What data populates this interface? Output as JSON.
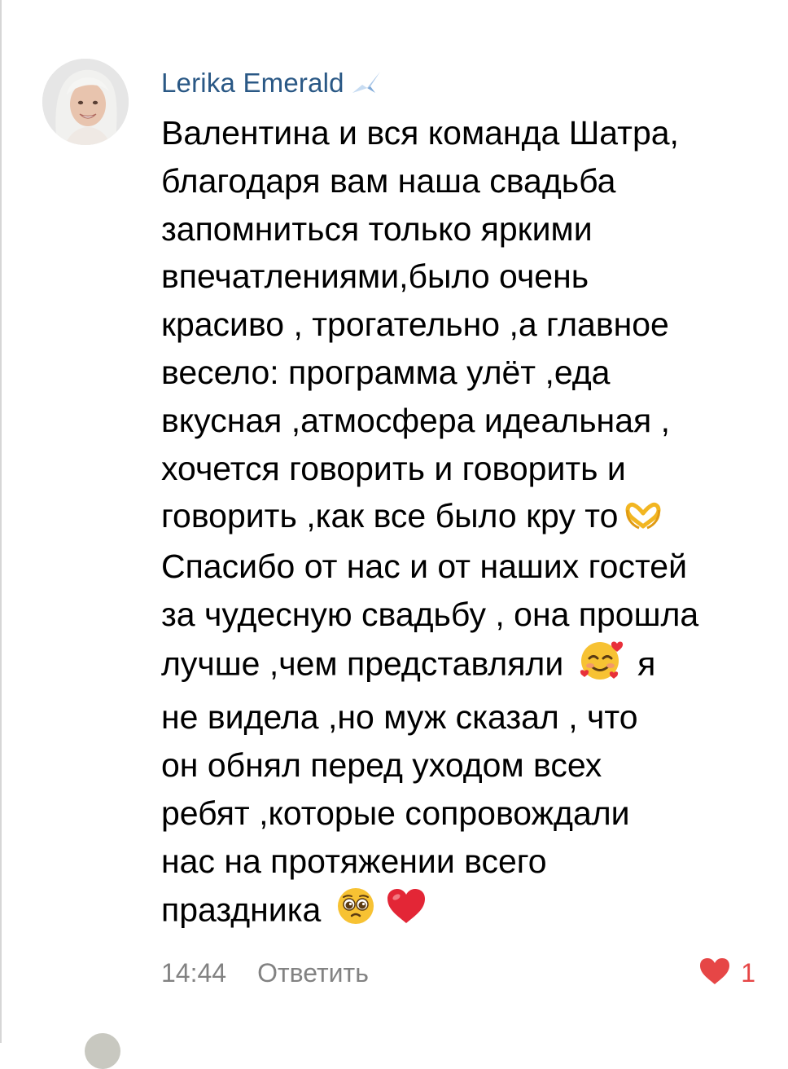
{
  "comment": {
    "author_name": "Lerika Emerald",
    "author_badge_icon": "origami-crane-icon",
    "body_lines": [
      "Валентина и вся команда Шатра,",
      "благодаря вам наша свадьба",
      "запомниться только яркими",
      "впечатлениями,было очень",
      "красиво , трогательно ,а главное",
      "весело: программа  улёт ,еда",
      "вкусная ,атмосфера идеальная ,",
      "хочется говорить и говорить и",
      "говорить ,как все было кру то",
      "Спасибо от нас и от наших гостей",
      "за чудесную свадьбу , она прошла",
      "лучше ,чем представляли",
      "я",
      "не видела ,но муж сказал , что",
      "он обнял перед уходом всех",
      "ребят ,которые сопровождали",
      "нас на протяжении всего",
      "праздника"
    ],
    "emojis": {
      "heart_hands": "heart-hands-emoji",
      "smiling_hearts": "smiling-face-with-hearts-emoji",
      "pleading": "pleading-face-emoji",
      "red_heart": "red-heart-emoji"
    },
    "time": "14:44",
    "reply_label": "Ответить",
    "like_count": "1",
    "colors": {
      "author": "#2a5885",
      "meta": "#828282",
      "like": "#e64646"
    }
  }
}
